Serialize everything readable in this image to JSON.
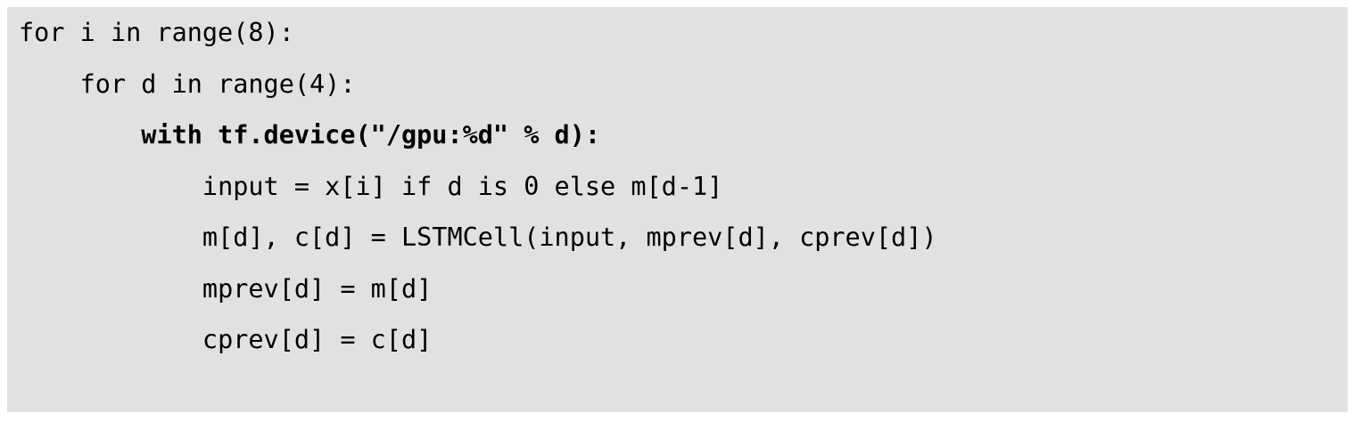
{
  "code": {
    "lines": [
      {
        "indent": "",
        "text": "for i in range(8):"
      },
      {
        "indent": "    ",
        "text": "for d in range(4):"
      },
      {
        "indent": "        ",
        "text": "with tf.device(\"/gpu:%d\" % d):"
      },
      {
        "indent": "            ",
        "text": "input = x[i] if d is 0 else m[d-1]"
      },
      {
        "indent": "            ",
        "text": "m[d], c[d] = LSTMCell(input, mprev[d], cprev[d])"
      },
      {
        "indent": "            ",
        "text": "mprev[d] = m[d]"
      },
      {
        "indent": "            ",
        "text": "cprev[d] = c[d]"
      }
    ],
    "background_color": "#e1e1e1",
    "text_color": "#000000"
  }
}
